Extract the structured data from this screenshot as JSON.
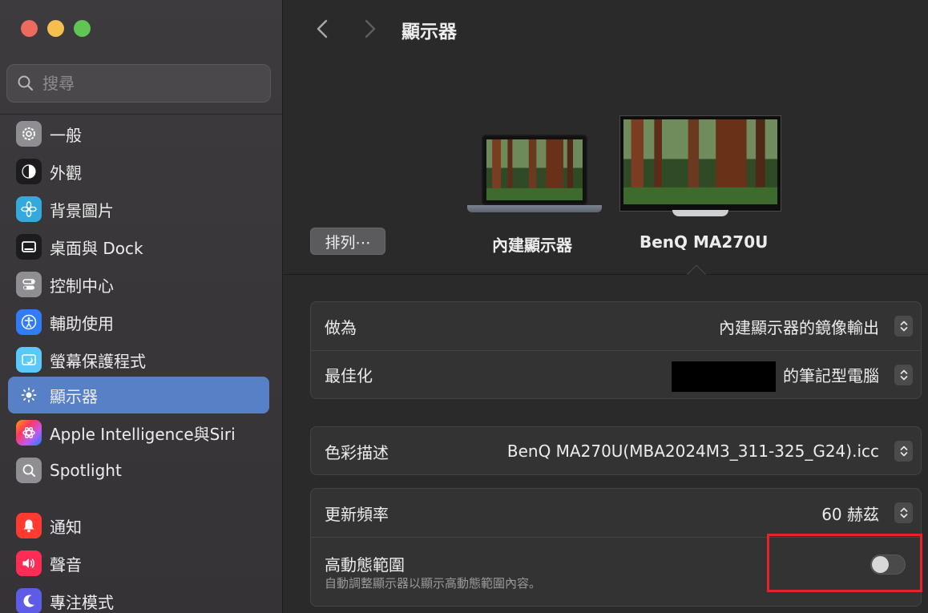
{
  "search": {
    "placeholder": "搜尋"
  },
  "sidebar": {
    "items": [
      {
        "label": "一般",
        "icon": "gear-icon",
        "color": "#8e8e93"
      },
      {
        "label": "外觀",
        "icon": "appearance-icon",
        "color": "#1c1c1e"
      },
      {
        "label": "背景圖片",
        "icon": "wallpaper-icon",
        "color": "#34aadc"
      },
      {
        "label": "桌面與 Dock",
        "icon": "dock-icon",
        "color": "#1c1c1e"
      },
      {
        "label": "控制中心",
        "icon": "control-center-icon",
        "color": "#8e8e93"
      },
      {
        "label": "輔助使用",
        "icon": "accessibility-icon",
        "color": "#2f7cf6"
      },
      {
        "label": "螢幕保護程式",
        "icon": "screensaver-icon",
        "color": "#5ac8fa"
      },
      {
        "label": "顯示器",
        "icon": "display-icon",
        "color": "#2f7cf6",
        "selected": true
      },
      {
        "label": "Apple Intelligence與Siri",
        "icon": "siri-icon",
        "color": "#ff6ba8"
      },
      {
        "label": "Spotlight",
        "icon": "spotlight-icon",
        "color": "#8e8e93"
      },
      {
        "label": "通知",
        "icon": "bell-icon",
        "color": "#ff3b30"
      },
      {
        "label": "聲音",
        "icon": "speaker-icon",
        "color": "#ff2d55"
      },
      {
        "label": "專注模式",
        "icon": "moon-icon",
        "color": "#5e5ce6"
      }
    ]
  },
  "header": {
    "title": "顯示器"
  },
  "displays": {
    "arrange_label": "排列⋯",
    "builtin_label": "內建顯示器",
    "external_label": "BenQ MA270U"
  },
  "settings": {
    "use_as": {
      "label": "做為",
      "value": "內建顯示器的鏡像輸出"
    },
    "optimize": {
      "label": "最佳化",
      "value": "的筆記型電腦"
    },
    "color_profile": {
      "label": "色彩描述",
      "value": "BenQ MA270U(MBA2024M3_311-325_G24).icc"
    },
    "refresh_rate": {
      "label": "更新頻率",
      "value": "60 赫茲"
    },
    "hdr": {
      "label": "高動態範圍",
      "description": "自動調整顯示器以顯示高動態範圍內容。",
      "enabled": false
    }
  },
  "colors": {
    "accent": "#5780c6",
    "highlight": "#e8212b"
  }
}
